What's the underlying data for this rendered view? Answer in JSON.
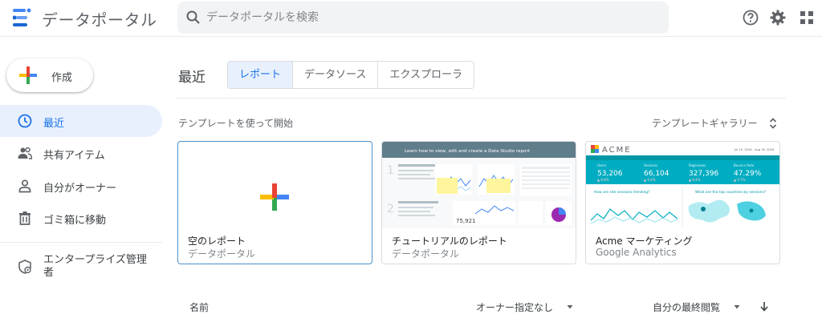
{
  "app": {
    "title": "データポータル"
  },
  "search": {
    "placeholder": "データポータルを検索"
  },
  "create": {
    "label": "作成"
  },
  "sidebar": {
    "items": [
      {
        "label": "最近"
      },
      {
        "label": "共有アイテム"
      },
      {
        "label": "自分がオーナー"
      },
      {
        "label": "ゴミ箱に移動"
      },
      {
        "label": "エンタープライズ管理者"
      }
    ]
  },
  "main": {
    "title": "最近",
    "tabs": [
      {
        "label": "レポート"
      },
      {
        "label": "データソース"
      },
      {
        "label": "エクスプローラ"
      }
    ]
  },
  "templates": {
    "title": "テンプレートを使って開始",
    "gallery_label": "テンプレートギャラリー",
    "cards": [
      {
        "name": "空のレポート",
        "source": "データポータル"
      },
      {
        "name": "チュートリアルのレポート",
        "source": "データポータル",
        "thumb_header": "Learn how to view, edit and create a Data Studio report",
        "thumb_stat": "75,921"
      },
      {
        "name": "Acme マーケティング",
        "source": "Google Analytics",
        "thumb_logo": "ACME",
        "thumb_date": "Jul 19, 2016 - Aug 16, 2016",
        "thumb_metrics": [
          {
            "label": "Users",
            "value": "53,206",
            "delta": "▲ 8.8%"
          },
          {
            "label": "Sessions",
            "value": "66,104",
            "delta": "▲ 9.4%"
          },
          {
            "label": "Pageviews",
            "value": "327,396",
            "delta": "▲ 8.4%"
          },
          {
            "label": "Bounce Rate",
            "value": "47.29%",
            "delta": "▲ 0.7%"
          }
        ],
        "thumb_chart_title": "How are site sessions trending?",
        "thumb_map_title": "What are the top countries by sessions?"
      }
    ]
  },
  "list": {
    "name_col": "名前",
    "owner_filter": "オーナー指定なし",
    "sort_label": "自分の最終閲覧"
  },
  "colors": {
    "accent": "#1a73e8",
    "active_bg": "#e8f0fe",
    "acme_teal": "#00acc1"
  }
}
